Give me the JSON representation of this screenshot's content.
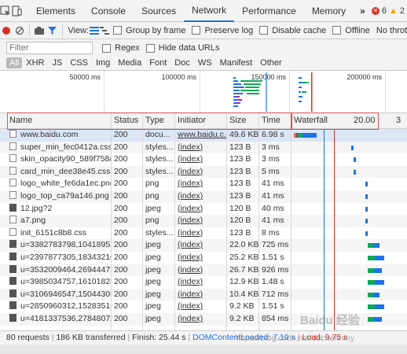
{
  "tabs": [
    "Elements",
    "Console",
    "Sources",
    "Network",
    "Performance",
    "Memory"
  ],
  "tabs_more": "»",
  "errors": {
    "error_count": "6",
    "warning_count": "2"
  },
  "toolbar": {
    "view_label": "View:",
    "group_by_frame": "Group by frame",
    "preserve_log": "Preserve log",
    "disable_cache": "Disable cache",
    "offline": "Offline",
    "throttle": "No throt"
  },
  "filter": {
    "placeholder": "Filter",
    "regex": "Regex",
    "hide_data_urls": "Hide data URLs"
  },
  "types": [
    "All",
    "XHR",
    "JS",
    "CSS",
    "Img",
    "Media",
    "Font",
    "Doc",
    "WS",
    "Manifest",
    "Other"
  ],
  "overview_ticks": [
    "50000 ms",
    "100000 ms",
    "150000 ms",
    "200000 ms"
  ],
  "columns": {
    "name": "Name",
    "status": "Status",
    "type": "Type",
    "initiator": "Initiator",
    "size": "Size",
    "time": "Time",
    "waterfall": "Waterfall",
    "waterfall_time": "20.00",
    "waterfall_time2": "3"
  },
  "rows": [
    {
      "name": "www.baidu.com",
      "status": "200",
      "type": "docu...",
      "initiator": "www.baidu.c...",
      "size": "49.6 KB",
      "time": "6.98 s",
      "icon": "doc",
      "wf": [
        0.02,
        0.22
      ]
    },
    {
      "name": "super_min_fec0412a.css",
      "status": "200",
      "type": "styles...",
      "initiator": "(index)",
      "size": "123 B",
      "time": "3 ms",
      "icon": "doc",
      "wf": [
        0.52,
        0.54
      ]
    },
    {
      "name": "skin_opacity90_589f758a.css",
      "status": "200",
      "type": "styles...",
      "initiator": "(index)",
      "size": "123 B",
      "time": "3 ms",
      "icon": "doc",
      "wf": [
        0.54,
        0.56
      ]
    },
    {
      "name": "card_min_dee38e45.css",
      "status": "200",
      "type": "styles...",
      "initiator": "(index)",
      "size": "123 B",
      "time": "5 ms",
      "icon": "doc",
      "wf": [
        0.54,
        0.56
      ]
    },
    {
      "name": "logo_white_fe6da1ec.png",
      "status": "200",
      "type": "png",
      "initiator": "(index)",
      "size": "123 B",
      "time": "41 ms",
      "icon": "doc",
      "wf": [
        0.64,
        0.66
      ]
    },
    {
      "name": "logo_top_ca79a146.png",
      "status": "200",
      "type": "png",
      "initiator": "(index)",
      "size": "123 B",
      "time": "41 ms",
      "icon": "doc",
      "wf": [
        0.64,
        0.66
      ]
    },
    {
      "name": "12.jpg?2",
      "status": "200",
      "type": "jpeg",
      "initiator": "(index)",
      "size": "120 B",
      "time": "40 ms",
      "icon": "img",
      "wf": [
        0.64,
        0.66
      ]
    },
    {
      "name": "a7.png",
      "status": "200",
      "type": "png",
      "initiator": "(index)",
      "size": "120 B",
      "time": "41 ms",
      "icon": "doc",
      "wf": [
        0.64,
        0.66
      ]
    },
    {
      "name": "init_6151c8b8.css",
      "status": "200",
      "type": "styles...",
      "initiator": "(index)",
      "size": "123 B",
      "time": "8 ms",
      "icon": "doc",
      "wf": [
        0.64,
        0.66
      ]
    },
    {
      "name": "u=3382783798,104189575...",
      "status": "200",
      "type": "jpeg",
      "initiator": "(index)",
      "size": "22.0 KB",
      "time": "725 ms",
      "icon": "img",
      "wf": [
        0.66,
        0.76
      ]
    },
    {
      "name": "u=2397877305,183432100...",
      "status": "200",
      "type": "jpeg",
      "initiator": "(index)",
      "size": "25.2 KB",
      "time": "1.51 s",
      "icon": "img",
      "wf": [
        0.66,
        0.8
      ]
    },
    {
      "name": "u=3532009464,269444732...",
      "status": "200",
      "type": "jpeg",
      "initiator": "(index)",
      "size": "26.7 KB",
      "time": "926 ms",
      "icon": "img",
      "wf": [
        0.66,
        0.78
      ]
    },
    {
      "name": "u=3985034757,161018282...",
      "status": "200",
      "type": "jpeg",
      "initiator": "(index)",
      "size": "12.9 KB",
      "time": "1.48 s",
      "icon": "img",
      "wf": [
        0.66,
        0.8
      ]
    },
    {
      "name": "u=3106946547,150443064...",
      "status": "200",
      "type": "jpeg",
      "initiator": "(index)",
      "size": "10.4 KB",
      "time": "712 ms",
      "icon": "img",
      "wf": [
        0.66,
        0.76
      ]
    },
    {
      "name": "u=2850960312,152835159...",
      "status": "200",
      "type": "jpeg",
      "initiator": "(index)",
      "size": "9.2 KB",
      "time": "1.51 s",
      "icon": "img",
      "wf": [
        0.66,
        0.8
      ]
    },
    {
      "name": "u=4181337536,278480728...",
      "status": "200",
      "type": "jpeg",
      "initiator": "(index)",
      "size": "9.2 KB",
      "time": "854 ms",
      "icon": "img",
      "wf": [
        0.66,
        0.78
      ]
    }
  ],
  "status": {
    "requests": "80 requests",
    "transferred": "186 KB transferred",
    "finish": "Finish: 25.44 s",
    "dcl": "DOMContentLoaded: 7.19 s",
    "load": "Load: 9.75 s"
  },
  "watermark": {
    "text": "Baidu 经验",
    "url": "https://blog.csdn.net/duchenhmy"
  },
  "colors": {
    "accent": "#1a73e8",
    "record": "#d93025",
    "highlight": "#e05050",
    "dcl": "#1a73e8",
    "load": "#d93025"
  }
}
